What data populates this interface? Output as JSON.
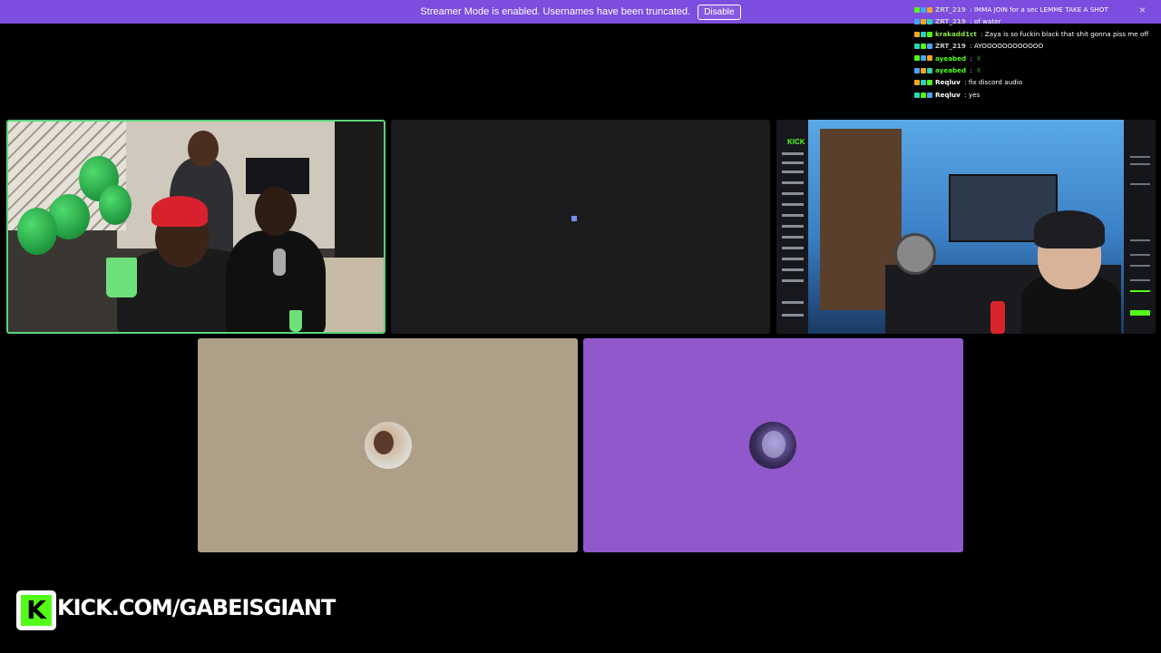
{
  "banner": {
    "text": "Streamer Mode is enabled. Usernames have been truncated.",
    "button_label": "Disable",
    "close_icon": "×",
    "color": "#7c4dde"
  },
  "chat": {
    "messages": [
      {
        "user": "ZRT_219",
        "sep": " : ",
        "text": "IMMA JOIN for a sec LEMME TAKE A SHOT",
        "color": "#c9c9c9",
        "emote": ""
      },
      {
        "user": "ZRT_219",
        "sep": " : ",
        "text": "of water",
        "color": "#c9c9c9",
        "emote": ""
      },
      {
        "user": "krakadd1ct",
        "sep": " : ",
        "text": "Zaya is so fuckin black that shit gonna piss me off",
        "color": "#8fe34b",
        "emote": ""
      },
      {
        "user": "ZRT_219",
        "sep": " : ",
        "text": "AYOOOOOOOOOOOO",
        "color": "#c9c9c9",
        "emote": ""
      },
      {
        "user": "ayeabed",
        "sep": " : ",
        "text": "",
        "color": "#53fc18",
        "emote": "✌"
      },
      {
        "user": "ayeabed",
        "sep": " : ",
        "text": "",
        "color": "#53fc18",
        "emote": "✌"
      },
      {
        "user": "Reqluv",
        "sep": " : ",
        "text": "fix discord audio",
        "color": "#ffffff",
        "emote": ""
      },
      {
        "user": "Reqluv",
        "sep": " : ",
        "text": "yes",
        "color": "#ffffff",
        "emote": ""
      }
    ]
  },
  "tiles": {
    "speaking_color": "#5bd47c",
    "tile4_color": "#ad9f88",
    "tile5_color": "#9158cc"
  },
  "tile3": {
    "logo": "KICK"
  },
  "watermark": {
    "logo_letter": "K",
    "url": "KICK.COM/GABEISGIANT",
    "brand_color": "#53fc18"
  }
}
